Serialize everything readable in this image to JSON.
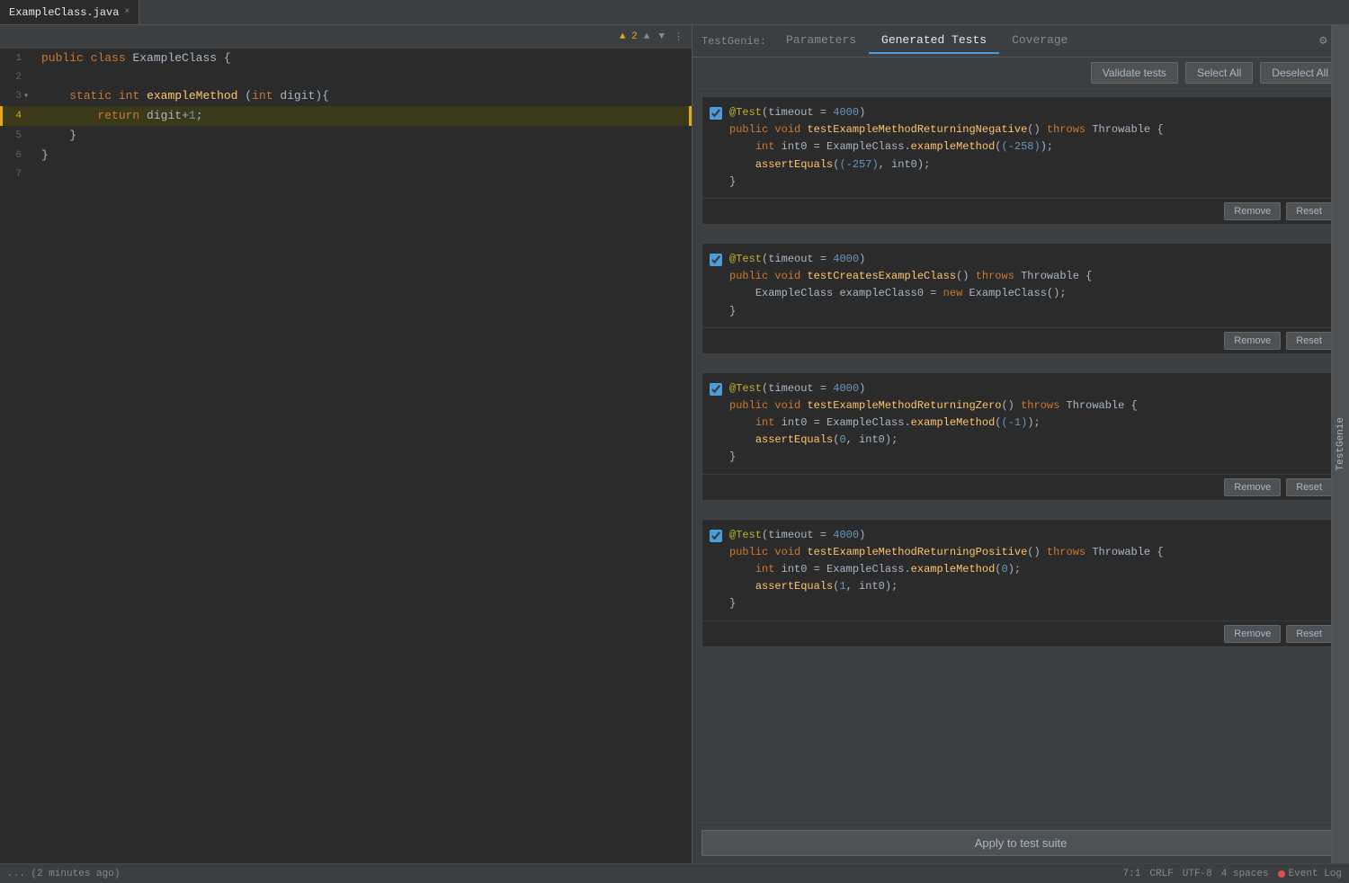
{
  "tab": {
    "filename": "ExampleClass.java",
    "close": "×"
  },
  "editor": {
    "warning_count": "▲ 2",
    "lines": [
      {
        "num": "1",
        "has_fold": false,
        "highlighted": false,
        "active": false,
        "content": "public class ExampleClass {"
      },
      {
        "num": "2",
        "has_fold": false,
        "highlighted": false,
        "active": false,
        "content": ""
      },
      {
        "num": "3",
        "has_fold": true,
        "highlighted": false,
        "active": false,
        "content": "    static int exampleMethod (int digit){"
      },
      {
        "num": "4",
        "has_fold": false,
        "highlighted": true,
        "active": true,
        "content": "        return digit+1;"
      },
      {
        "num": "5",
        "has_fold": false,
        "highlighted": false,
        "active": false,
        "content": "    }"
      },
      {
        "num": "6",
        "has_fold": false,
        "highlighted": false,
        "active": false,
        "content": "}"
      },
      {
        "num": "7",
        "has_fold": false,
        "highlighted": false,
        "active": false,
        "content": ""
      }
    ]
  },
  "right_panel": {
    "label": "TestGenie:",
    "tabs": [
      "Parameters",
      "Generated Tests",
      "Coverage"
    ],
    "active_tab": "Generated Tests",
    "buttons": {
      "validate": "Validate tests",
      "select_all": "Select All",
      "deselect_all": "Deselect All"
    }
  },
  "tests": [
    {
      "id": 1,
      "checked": true,
      "annotation": "@Test(timeout = 4000)",
      "signature": "public void testExampleMethodReturningNegative() throws Throwable {",
      "body_lines": [
        "    int int0 = ExampleClass.exampleMethod((-258));",
        "    assertEquals((-257), int0);"
      ],
      "closing": "}",
      "remove_label": "Remove",
      "reset_label": "Reset"
    },
    {
      "id": 2,
      "checked": true,
      "annotation": "@Test(timeout = 4000)",
      "signature": "public void testCreatesExampleClass() throws Throwable {",
      "body_lines": [
        "    ExampleClass exampleClass0 = new ExampleClass();"
      ],
      "closing": "}",
      "remove_label": "Remove",
      "reset_label": "Reset"
    },
    {
      "id": 3,
      "checked": true,
      "annotation": "@Test(timeout = 4000)",
      "signature": "public void testExampleMethodReturningZero() throws Throwable {",
      "body_lines": [
        "    int int0 = ExampleClass.exampleMethod((-1));",
        "    assertEquals(0, int0);"
      ],
      "closing": "}",
      "remove_label": "Remove",
      "reset_label": "Reset"
    },
    {
      "id": 4,
      "checked": true,
      "annotation": "@Test(timeout = 4000)",
      "signature": "public void testExampleMethodReturningPositive() throws Throwable {",
      "body_lines": [
        "    int int0 = ExampleClass.exampleMethod(0);",
        "    assertEquals(1, int0);"
      ],
      "closing": "}",
      "remove_label": "Remove",
      "reset_label": "Reset"
    }
  ],
  "apply_btn_label": "Apply to test suite",
  "status_bar": {
    "left": "... (2 minutes ago)",
    "position": "7:1",
    "line_ending": "CRLF",
    "encoding": "UTF-8",
    "indent": "4 spaces",
    "event_log": "Event Log"
  },
  "side_tab_label": "TestGenie"
}
